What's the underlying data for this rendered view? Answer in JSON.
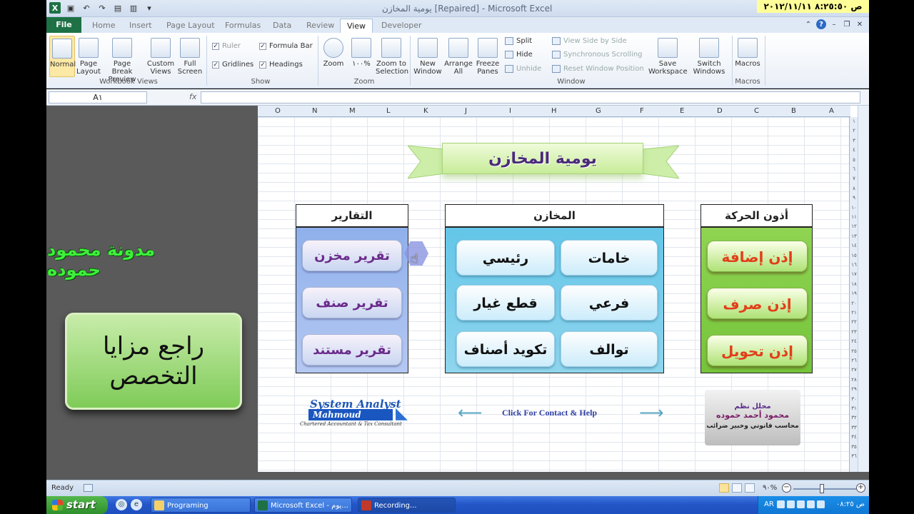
{
  "window": {
    "title": "يومية المخازن [Repaired]  -  Microsoft Excel",
    "clock": "ص ٨:٢٥:٥٠ ٢٠١٢/١١/١١"
  },
  "tabs": [
    "File",
    "Home",
    "Insert",
    "Page Layout",
    "Formulas",
    "Data",
    "Review",
    "View",
    "Developer"
  ],
  "active_tab": "View",
  "ribbon": {
    "workbook_views": {
      "label": "Workbook Views",
      "normal": "Normal",
      "page_layout": "Page Layout",
      "page_break": "Page Break Preview",
      "custom_views": "Custom Views",
      "full_screen": "Full Screen"
    },
    "show": {
      "label": "Show",
      "ruler": "Ruler",
      "formula_bar": "Formula Bar",
      "gridlines": "Gridlines",
      "headings": "Headings"
    },
    "zoom": {
      "label": "Zoom",
      "zoom": "Zoom",
      "hundred": "١٠٠%",
      "zoom_to_selection": "Zoom to Selection"
    },
    "window": {
      "label": "Window",
      "new_window": "New Window",
      "arrange_all": "Arrange All",
      "freeze_panes": "Freeze Panes",
      "split": "Split",
      "hide": "Hide",
      "unhide": "Unhide",
      "view_side": "View Side by Side",
      "sync_scroll": "Synchronous Scrolling",
      "reset_pos": "Reset Window Position",
      "save_workspace": "Save Workspace",
      "switch_windows": "Switch Windows"
    },
    "macros": {
      "label": "Macros",
      "macros": "Macros"
    }
  },
  "formula_bar": {
    "name_box": "A١",
    "fx": "fx",
    "value": ""
  },
  "columns": [
    "O",
    "N",
    "M",
    "L",
    "K",
    "J",
    "I",
    "H",
    "G",
    "F",
    "E",
    "D",
    "C",
    "B",
    "A"
  ],
  "rows": [
    "١",
    "٢",
    "٣",
    "٤",
    "٥",
    "٦",
    "٧",
    "٨",
    "٩",
    "١٠",
    "١١",
    "١٢",
    "١٣",
    "١٤",
    "١٥",
    "١٦",
    "١٧",
    "١٨",
    "١٩",
    "٢٠",
    "٢١",
    "٢٢",
    "٢٣",
    "٢٤",
    "٢٥",
    "٢٦",
    "٢٧",
    "٢٨",
    "٢٩",
    "٣٠",
    "٣١",
    "٣٢",
    "٣٣",
    "٣٤",
    "٣٥",
    "٣٦"
  ],
  "sheet": {
    "banner": "يومية المخازن",
    "reports": {
      "header": "التقارير",
      "buttons": [
        "تقرير مخزن",
        "تقرير صنف",
        "تقرير مستند"
      ]
    },
    "warehouses": {
      "header": "المخازن",
      "buttons": [
        "خامات",
        "رئيسي",
        "فرعي",
        "قطع غيار",
        "توالف",
        "تكويد أصناف"
      ]
    },
    "permits": {
      "header": "أذون الحركة",
      "buttons": [
        "إذن إضافة",
        "إذن صرف",
        "إذن تحويل"
      ]
    },
    "logo": {
      "line1": "System Analyst",
      "line2": "Mahmoud Hamouda",
      "line3": "Chartered Accountant & Tax Consultant"
    },
    "contact": "Click For Contact & Help",
    "stamp": {
      "line1": "محلل نظم",
      "line2": "محمود أحمد حموده",
      "line3": "محاسب قانوني وخبير ضرائب"
    }
  },
  "overlay": {
    "blog_title": "مدونة محمود حموده",
    "box_text": "راجع مزايا التخصص"
  },
  "status": {
    "ready": "Ready",
    "zoom": "٩٠%",
    "minus": "−",
    "plus": "+"
  },
  "taskbar": {
    "start": "start",
    "items": [
      "Programing",
      "Microsoft Excel - يوم...",
      "Recording..."
    ],
    "lang": "AR",
    "time": "ص ٠٨:٢٥"
  }
}
